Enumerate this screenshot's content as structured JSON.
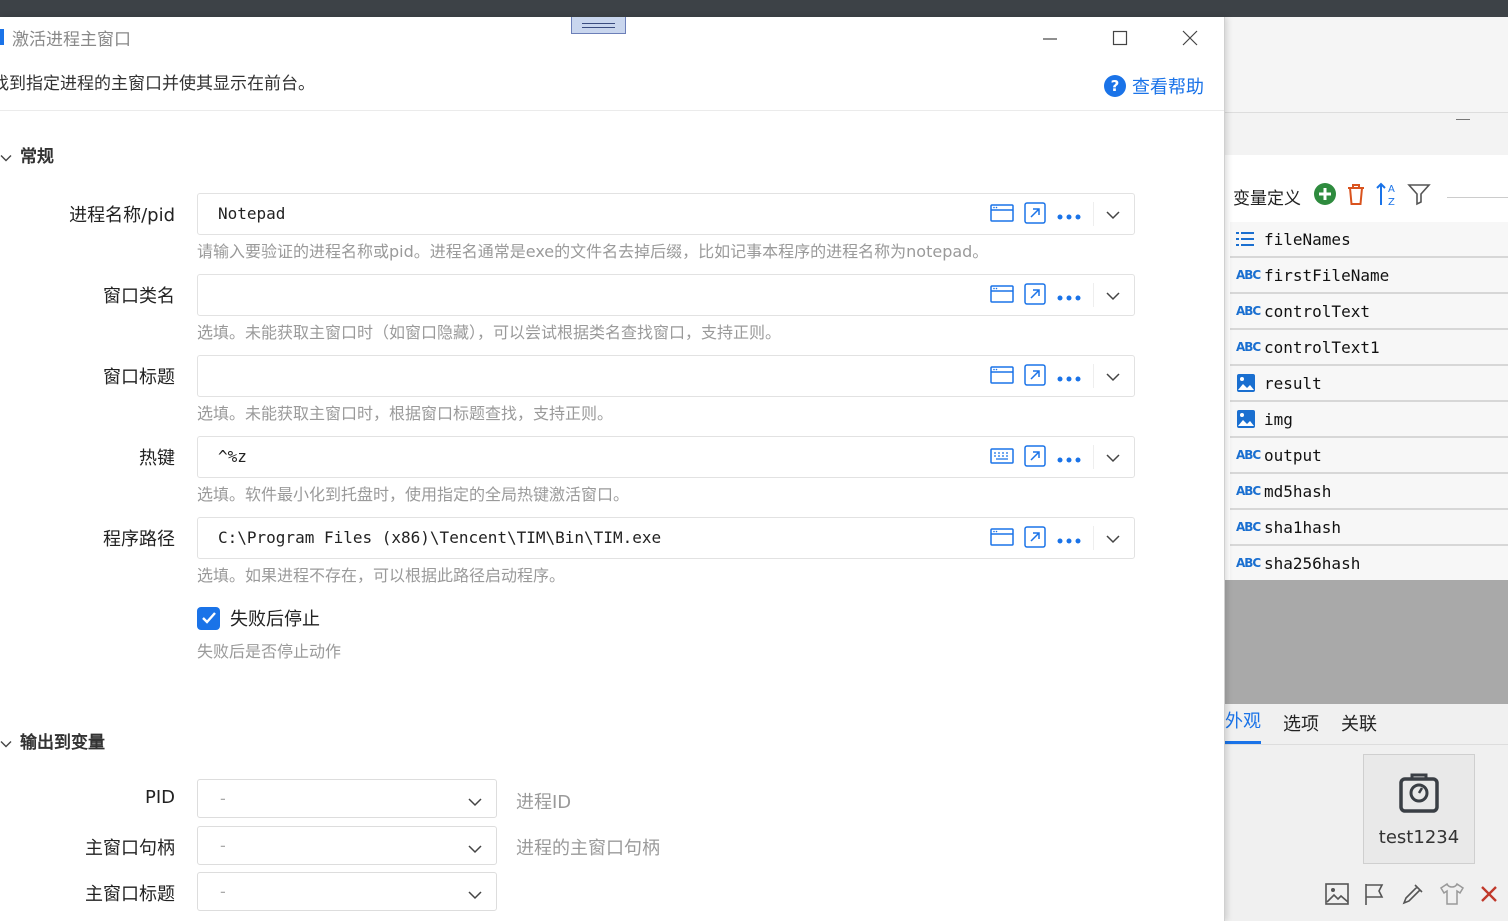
{
  "dialog": {
    "title": "激活进程主窗口",
    "description": "找到指定进程的主窗口并使其显示在前台。",
    "help_label": "查看帮助",
    "help_glyph": "?",
    "accent_color": "#1a73e8"
  },
  "general": {
    "section_title": "常规",
    "fields": [
      {
        "label": "进程名称/pid",
        "value": "Notepad",
        "hint": "请输入要验证的进程名称或pid。进程名通常是exe的文件名去掉后缀，比如记事本程序的进程名称为notepad。",
        "icon": "window-icon"
      },
      {
        "label": "窗口类名",
        "value": "",
        "hint": "选填。未能获取主窗口时（如窗口隐藏），可以尝试根据类名查找窗口，支持正则。",
        "icon": "window-icon"
      },
      {
        "label": "窗口标题",
        "value": "",
        "hint": "选填。未能获取主窗口时，根据窗口标题查找，支持正则。",
        "icon": "window-icon"
      },
      {
        "label": "热键",
        "value": "^%z",
        "hint": "选填。软件最小化到托盘时，使用指定的全局热键激活窗口。",
        "icon": "keyboard-icon"
      },
      {
        "label": "程序路径",
        "value": "C:\\Program Files (x86)\\Tencent\\TIM\\Bin\\TIM.exe",
        "hint": "选填。如果进程不存在，可以根据此路径启动程序。",
        "icon": "window-icon"
      }
    ],
    "stop_on_fail": {
      "label": "失败后停止",
      "hint": "失败后是否停止动作",
      "checked": true
    }
  },
  "output": {
    "section_title": "输出到变量",
    "rows": [
      {
        "label": "PID",
        "value": "-",
        "hint": "进程ID"
      },
      {
        "label": "主窗口句柄",
        "value": "-",
        "hint": "进程的主窗口句柄"
      },
      {
        "label": "主窗口标题",
        "value": "-",
        "hint": ""
      }
    ]
  },
  "variables_panel": {
    "title": "变量定义",
    "items": [
      {
        "name": "fileNames",
        "type": "list"
      },
      {
        "name": "firstFileName",
        "type": "text",
        "badge": "ABC"
      },
      {
        "name": "controlText",
        "type": "text",
        "badge": "ABC"
      },
      {
        "name": "controlText1",
        "type": "text",
        "badge": "ABC"
      },
      {
        "name": "result",
        "type": "image"
      },
      {
        "name": "img",
        "type": "image"
      },
      {
        "name": "output",
        "type": "text",
        "badge": "ABC"
      },
      {
        "name": "md5hash",
        "type": "text",
        "badge": "ABC"
      },
      {
        "name": "sha1hash",
        "type": "text",
        "badge": "ABC"
      },
      {
        "name": "sha256hash",
        "type": "text",
        "badge": "ABC"
      }
    ]
  },
  "properties_panel": {
    "tabs": [
      "外观",
      "选项",
      "关联"
    ],
    "active_tab": "外观",
    "preview_label": "test1234"
  }
}
